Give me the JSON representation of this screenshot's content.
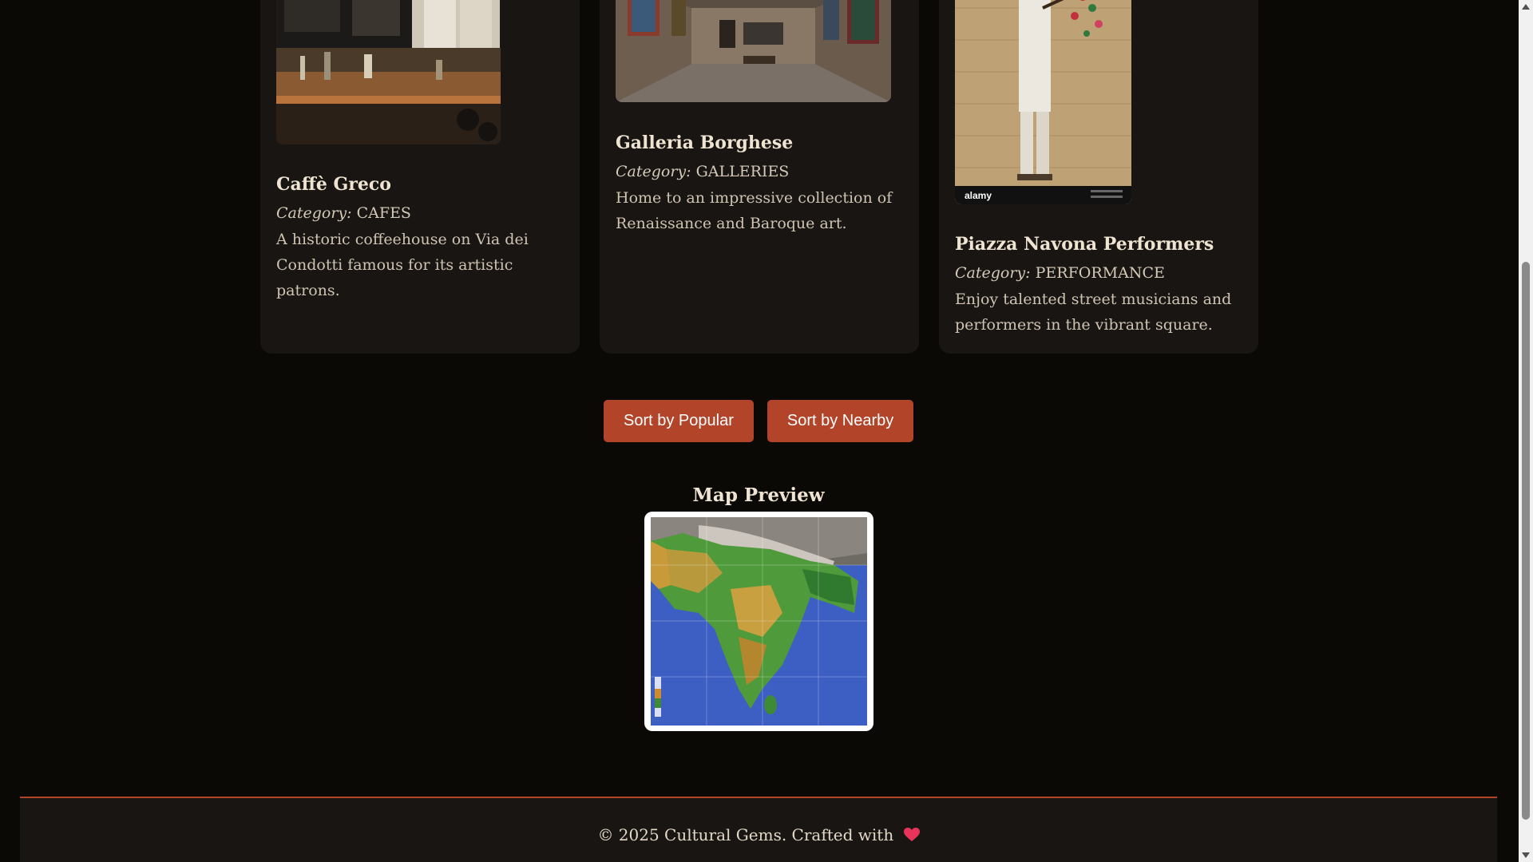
{
  "cards": [
    {
      "title": "Caffè Greco",
      "category_label": "Category:",
      "category": "CAFES",
      "description": "A historic coffeehouse on Via dei Condotti famous for its artistic patrons.",
      "image": "cafe-interior-photo"
    },
    {
      "title": "Galleria Borghese",
      "category_label": "Category:",
      "category": "GALLERIES",
      "description": "Home to an impressive collection of Renaissance and Baroque art.",
      "image": "gallery-hall-photo"
    },
    {
      "title": "Piazza Navona Performers",
      "category_label": "Category:",
      "category": "PERFORMANCE",
      "description": "Enjoy talented street musicians and performers in the vibrant square.",
      "image": "street-musician-photo",
      "watermark": "alamy"
    }
  ],
  "sort": {
    "popular_label": "Sort by Popular",
    "nearby_label": "Sort by Nearby"
  },
  "map": {
    "heading": "Map Preview",
    "image": "india-relief-map"
  },
  "footer": {
    "text": "© 2025 Cultural Gems. Crafted with",
    "icon": "heart-icon"
  },
  "colors": {
    "background": "#0b0906",
    "card_background": "#181512",
    "accent": "#b2442a",
    "text": "#e8dccb"
  }
}
